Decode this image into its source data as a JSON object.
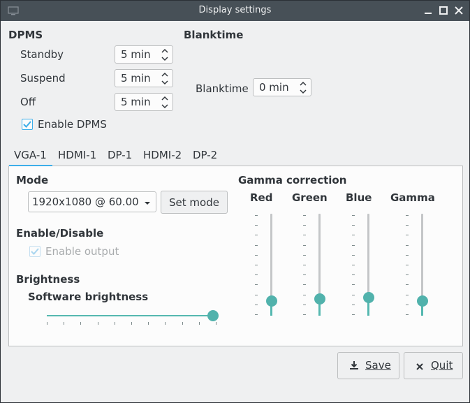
{
  "window": {
    "title": "Display settings"
  },
  "dpms": {
    "heading": "DPMS",
    "standby": {
      "label": "Standby",
      "value": "5 min"
    },
    "suspend": {
      "label": "Suspend",
      "value": "5 min"
    },
    "off": {
      "label": "Off",
      "value": "5 min"
    },
    "enable": {
      "label": "Enable DPMS",
      "checked": true
    }
  },
  "blanktime": {
    "heading": "Blanktime",
    "label": "Blanktime",
    "value": "0 min"
  },
  "tabs": [
    {
      "label": "VGA-1",
      "selected": true
    },
    {
      "label": "HDMI-1",
      "selected": false
    },
    {
      "label": "DP-1",
      "selected": false
    },
    {
      "label": "HDMI-2",
      "selected": false
    },
    {
      "label": "DP-2",
      "selected": false
    }
  ],
  "mode": {
    "heading": "Mode",
    "selected": "1920x1080 @ 60.00",
    "set_button": "Set mode"
  },
  "enable_disable": {
    "heading": "Enable/Disable",
    "checkbox_label": "Enable output",
    "checked": true,
    "disabled": true
  },
  "brightness": {
    "heading": "Brightness",
    "sub": "Software brightness",
    "level": 1.0
  },
  "gamma": {
    "heading": "Gamma correction",
    "channels": [
      {
        "label": "Red",
        "level": 0.1
      },
      {
        "label": "Green",
        "level": 0.12
      },
      {
        "label": "Blue",
        "level": 0.14
      },
      {
        "label": "Gamma",
        "level": 0.1
      }
    ]
  },
  "buttons": {
    "save": "Save",
    "quit": "Quit"
  },
  "colors": {
    "accent": "#3daee9",
    "slider": "#51b2ac",
    "titlebar": "#475057"
  }
}
